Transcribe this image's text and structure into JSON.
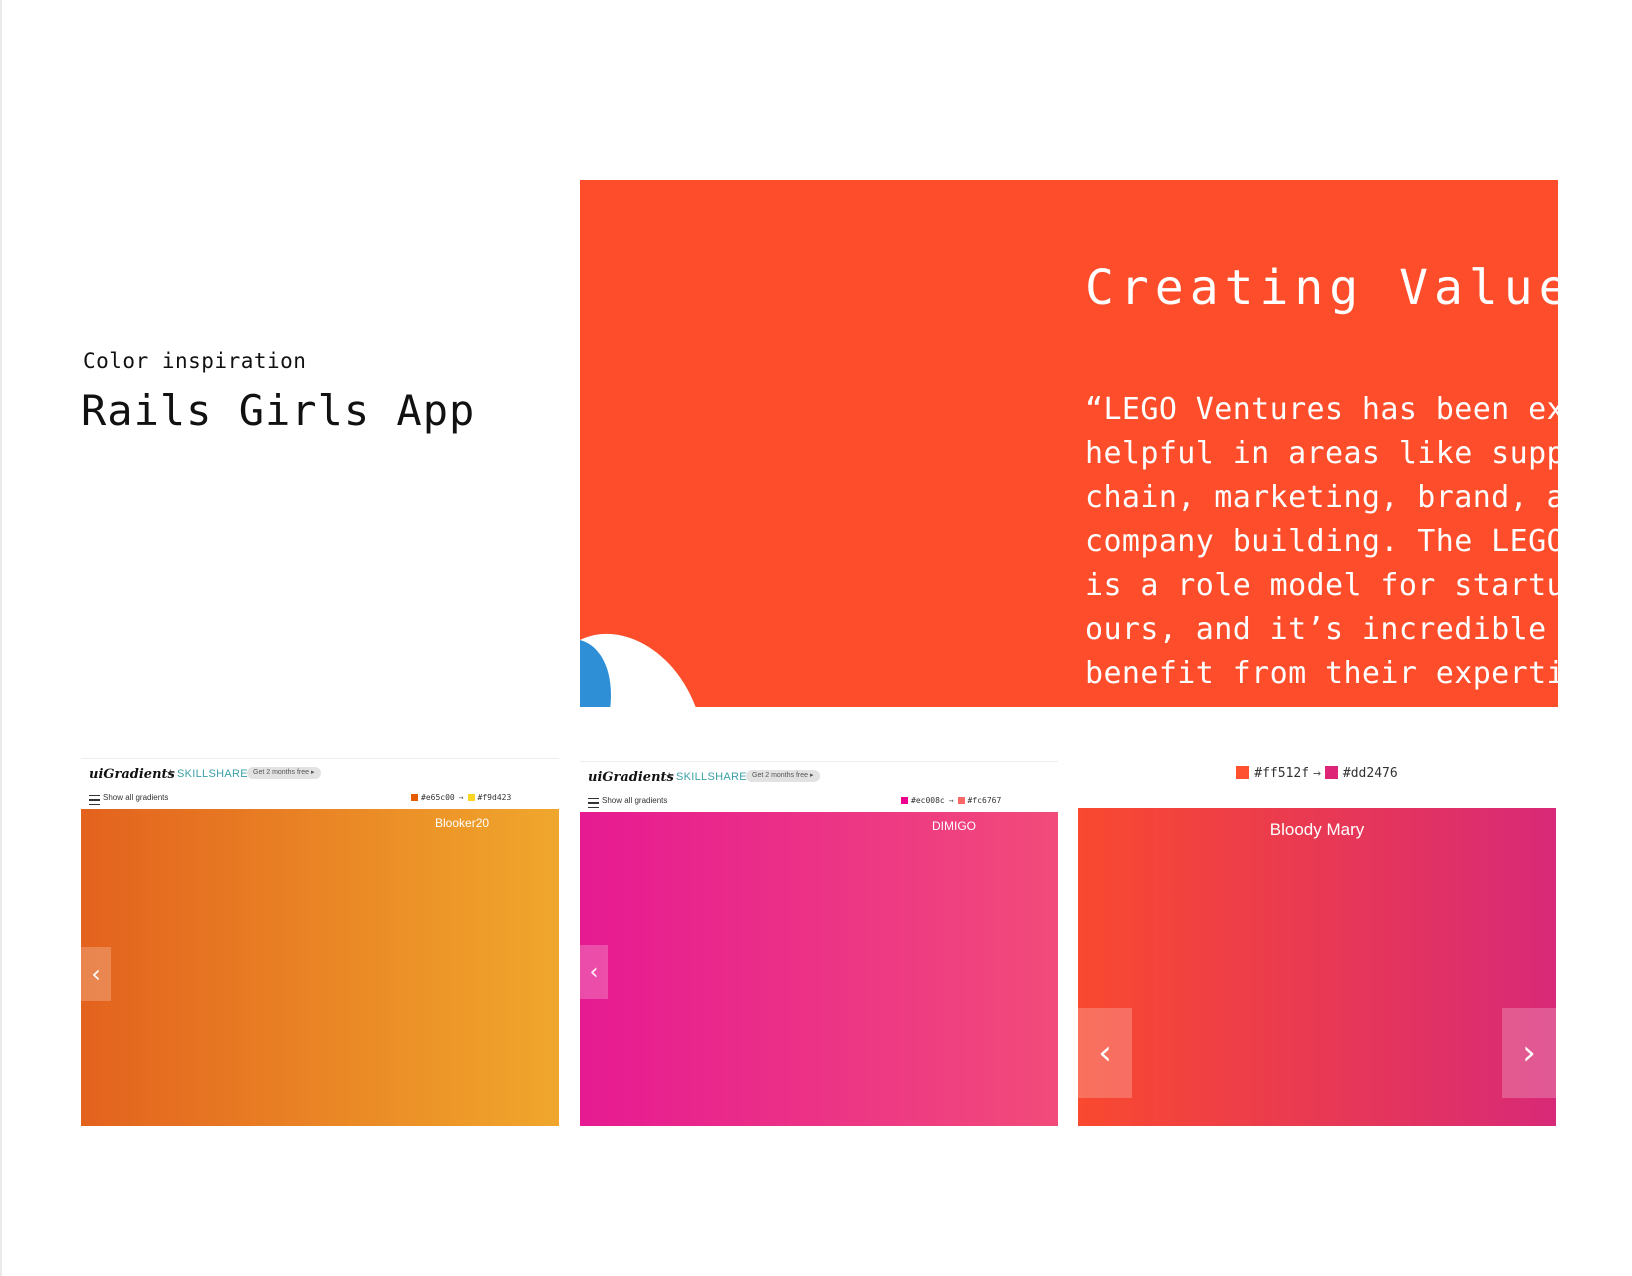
{
  "intro": {
    "subtitle": "Color inspiration",
    "title": "Rails Girls App"
  },
  "hero": {
    "bg_color": "#fd4d2a",
    "title": "Creating Value",
    "quote_lines": [
      "“LEGO Ventures has been ext",
      "helpful in areas like suppl",
      "chain, marketing, brand, ar",
      "company building. The LEGO",
      "is a role model for startup",
      "ours, and it’s incredible t",
      "benefit from their expertise"
    ]
  },
  "cards": [
    {
      "logo": "uiGradients",
      "plus": "+",
      "partner": "SKILLSHARE",
      "pill": "Get 2 months free ▸",
      "menu_label": "Show all gradients",
      "from_code": "#e65c00",
      "to_code": "#f9d423",
      "arrow": "→",
      "from_color": "#e65c00",
      "to_color": "#f9d423",
      "gradient_start": "#e3621e",
      "gradient_end": "#f0a72c",
      "name": "Blooker20",
      "prev_icon": "‹"
    },
    {
      "logo": "uiGradients",
      "plus": "+",
      "partner": "SKILLSHARE",
      "pill": "Get 2 months free ▸",
      "menu_label": "Show all gradients",
      "from_code": "#ec008c",
      "to_code": "#fc6767",
      "arrow": "→",
      "from_color": "#ec008c",
      "to_color": "#fc6767",
      "gradient_start": "#e61a92",
      "gradient_end": "#f24b7a",
      "name": "DIMIGO",
      "prev_icon": "‹"
    },
    {
      "from_code": "#ff512f",
      "to_code": "#dd2476",
      "arrow": "→",
      "from_color": "#ff512f",
      "to_color": "#dd2476",
      "gradient_start": "#f9492f",
      "gradient_end": "#d82978",
      "name": "Bloody Mary",
      "prev_icon": "‹",
      "next_icon": "›"
    }
  ]
}
